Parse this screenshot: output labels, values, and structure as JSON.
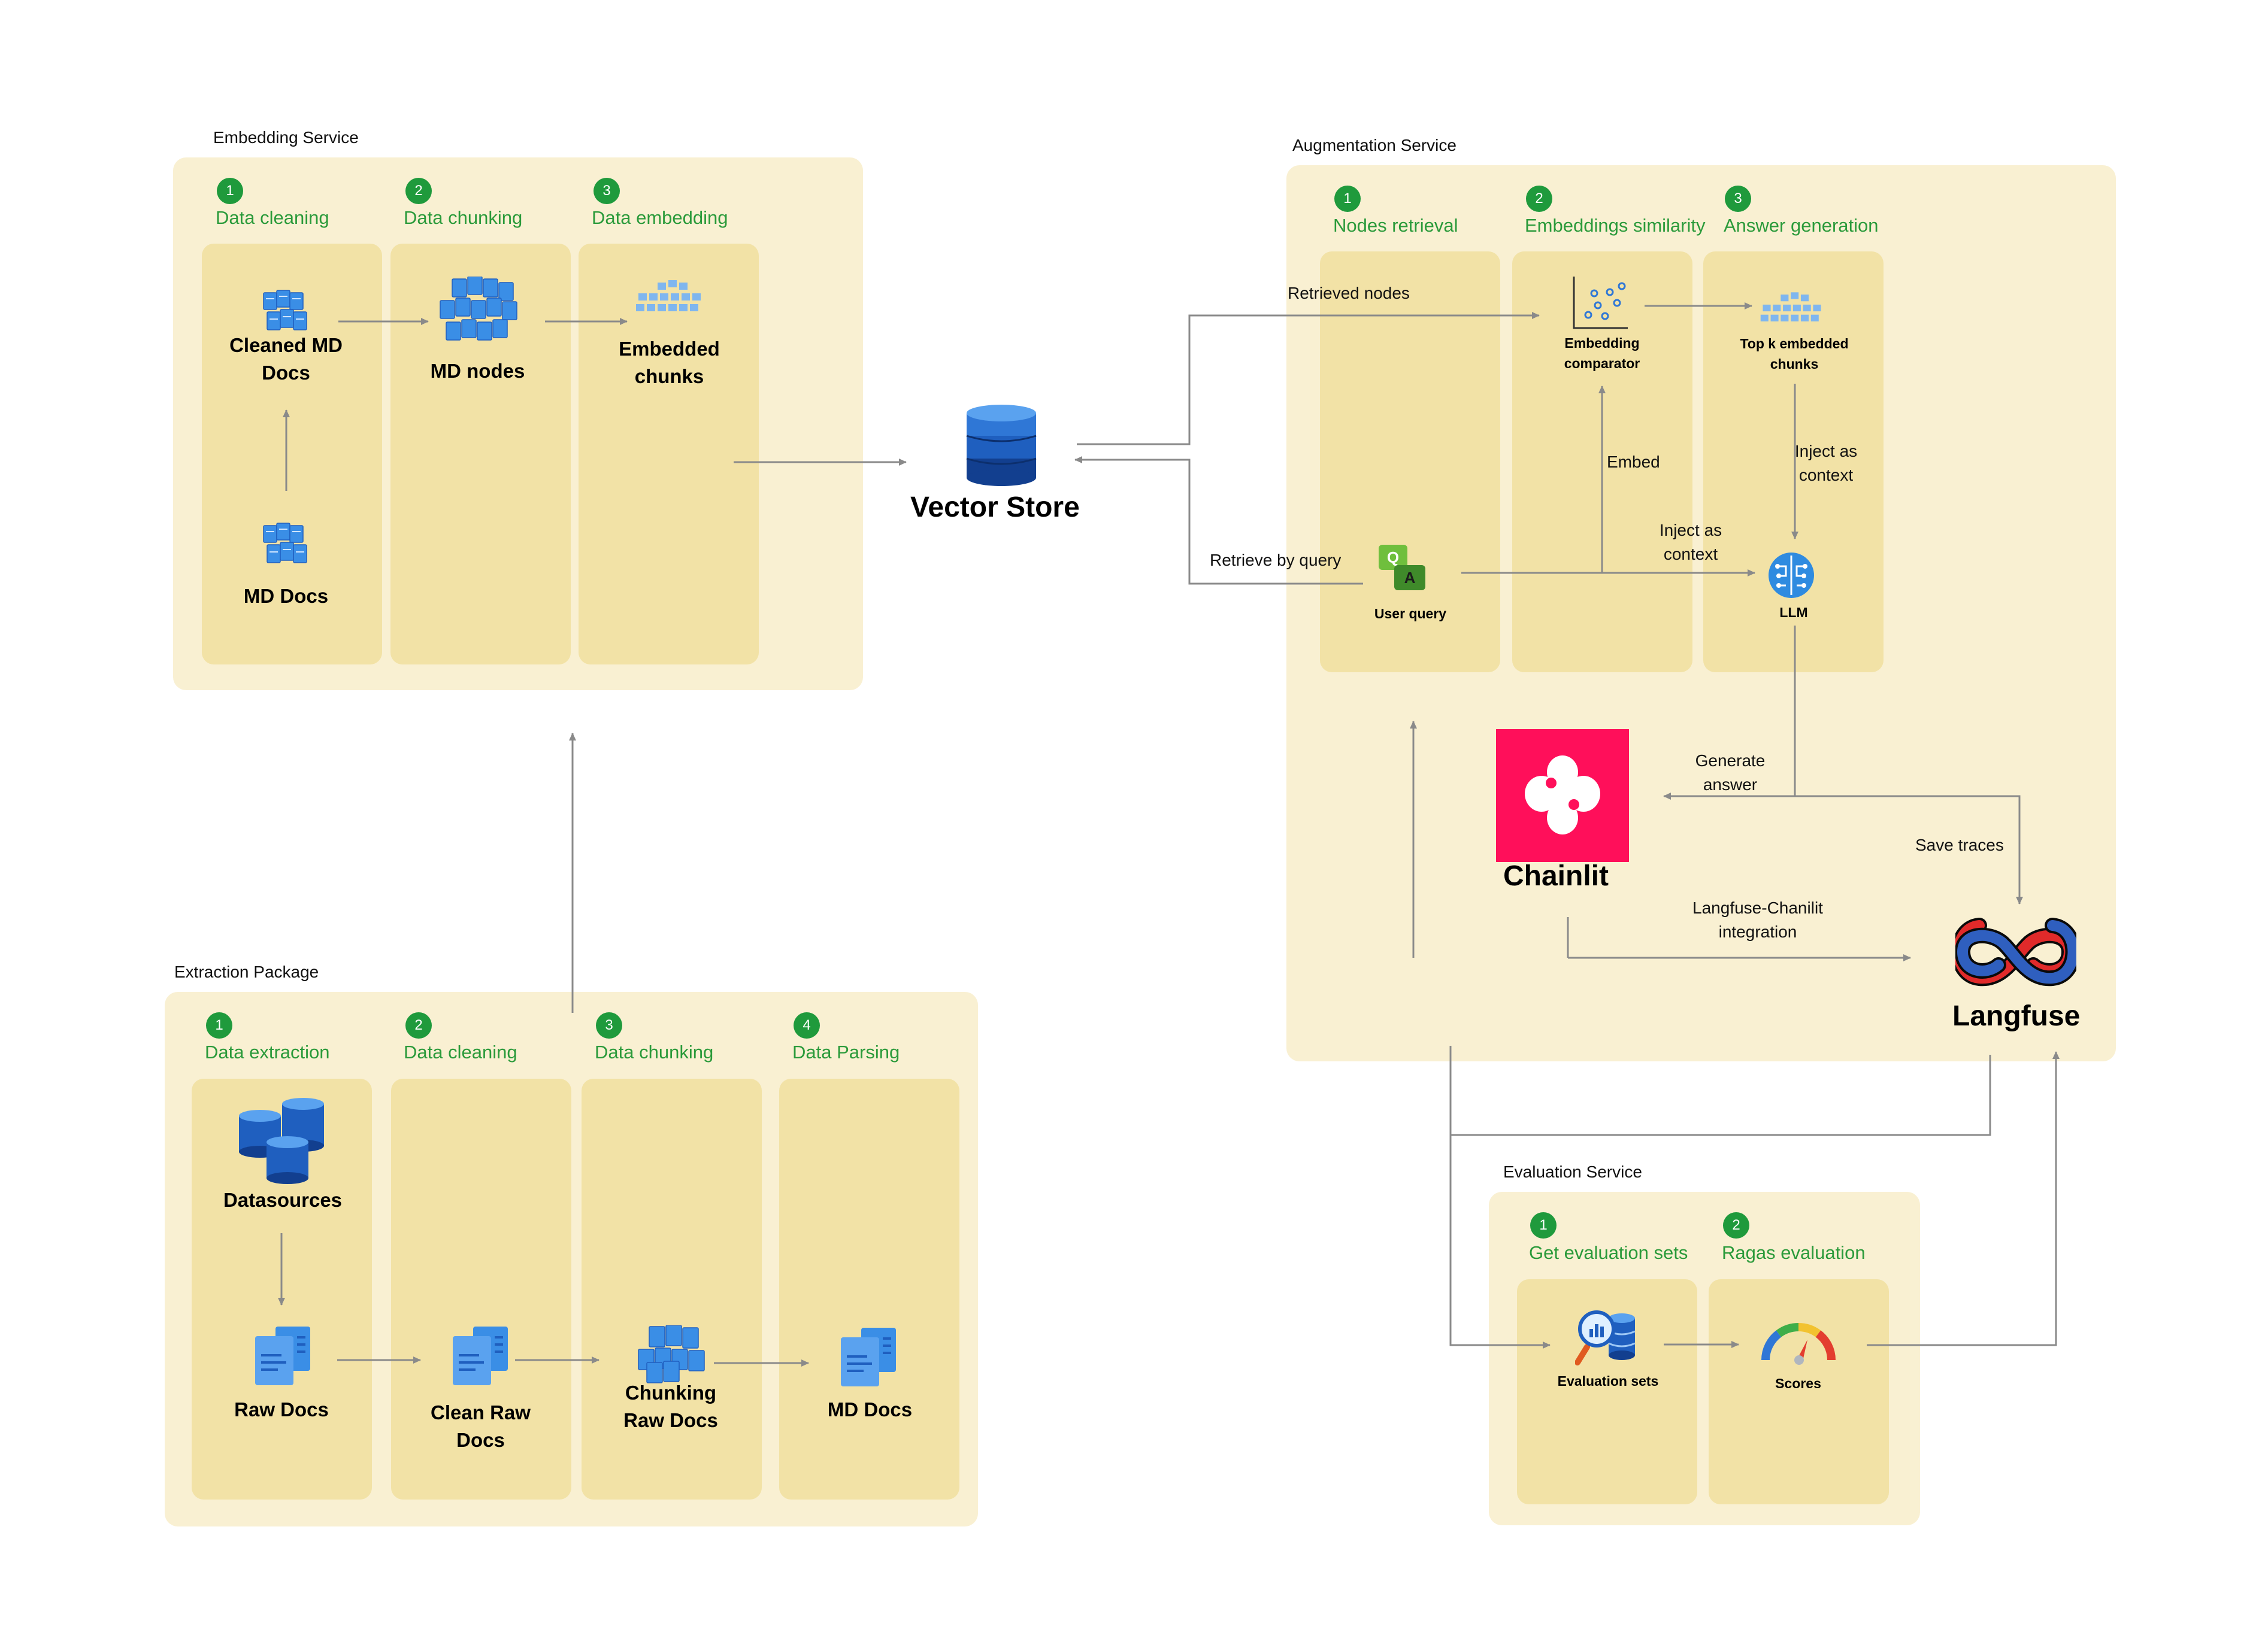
{
  "embedding_service": {
    "title": "Embedding Service",
    "steps": [
      {
        "num": "1",
        "label": "Data cleaning"
      },
      {
        "num": "2",
        "label": "Data chunking"
      },
      {
        "num": "3",
        "label": "Data embedding"
      }
    ],
    "nodes": {
      "cleaned_md_docs": "Cleaned MD Docs",
      "md_docs": "MD Docs",
      "md_nodes": "MD nodes",
      "embedded_chunks": "Embedded chunks"
    }
  },
  "vector_store": {
    "label": "Vector Store"
  },
  "augmentation_service": {
    "title": "Augmentation Service",
    "steps": [
      {
        "num": "1",
        "label": "Nodes retrieval"
      },
      {
        "num": "2",
        "label": "Embeddings similarity"
      },
      {
        "num": "3",
        "label": "Answer generation"
      }
    ],
    "nodes": {
      "embedding_comparator": "Embedding comparator",
      "top_k": "Top k embedded chunks",
      "user_query": "User query",
      "llm": "LLM",
      "qa_q": "Q",
      "qa_a": "A"
    },
    "edges": {
      "retrieved_nodes": "Retrieved nodes",
      "retrieve_by_query": "Retrieve by query",
      "embed": "Embed",
      "inject_context_1": "Inject as context",
      "inject_context_2": "Inject as context",
      "generate_answer": "Generate answer",
      "save_traces": "Save traces",
      "langfuse_chainlit": "Langfuse-Chanilit integration"
    }
  },
  "chainlit": {
    "label": "Chainlit",
    "color": "#ff0f5a"
  },
  "langfuse": {
    "label": "Langfuse"
  },
  "extraction_package": {
    "title": "Extraction Package",
    "steps": [
      {
        "num": "1",
        "label": "Data extraction"
      },
      {
        "num": "2",
        "label": "Data cleaning"
      },
      {
        "num": "3",
        "label": "Data chunking"
      },
      {
        "num": "4",
        "label": "Data Parsing"
      }
    ],
    "nodes": {
      "datasources": "Datasources",
      "raw_docs": "Raw Docs",
      "clean_raw_docs": "Clean Raw Docs",
      "chunking_raw_docs": "Chunking Raw Docs",
      "md_docs": "MD Docs"
    }
  },
  "evaluation_service": {
    "title": "Evaluation Service",
    "steps": [
      {
        "num": "1",
        "label": "Get evaluation sets"
      },
      {
        "num": "2",
        "label": "Ragas evaluation"
      }
    ],
    "nodes": {
      "evaluation_sets": "Evaluation sets",
      "scores": "Scores"
    }
  },
  "colors": {
    "panel": "#f9f0d2",
    "lane": "#f2e2a6",
    "step_green": "#1f9a3c",
    "step_label_green": "#2a9a3a",
    "wire": "#8a8a8a",
    "db_blue": "#1f5fbf"
  }
}
